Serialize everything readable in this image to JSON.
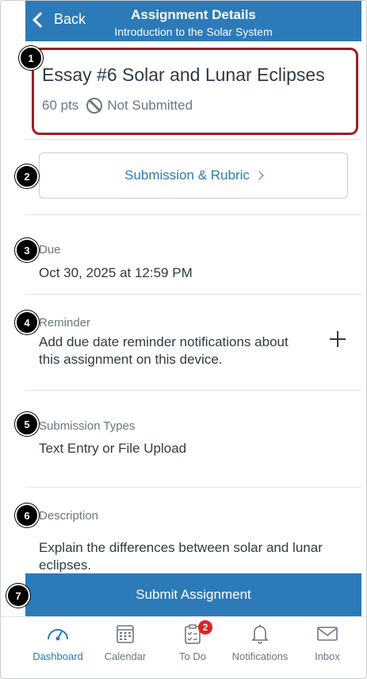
{
  "header": {
    "back_label": "Back",
    "title": "Assignment Details",
    "subtitle": "Introduction to the Solar System"
  },
  "assignment": {
    "title": "Essay #6 Solar and Lunar Eclipses",
    "points": "60 pts",
    "status": "Not Submitted"
  },
  "submission_button": {
    "label": "Submission & Rubric"
  },
  "due": {
    "label": "Due",
    "value": "Oct 30, 2025 at 12:59 PM"
  },
  "reminder": {
    "label": "Reminder",
    "text": "Add due date reminder notifications about this assignment on this device."
  },
  "submission_types": {
    "label": "Submission Types",
    "value": "Text Entry or File Upload"
  },
  "description": {
    "label": "Description",
    "text": "Explain the differences between solar and lunar eclipses."
  },
  "submit": {
    "label": "Submit Assignment"
  },
  "tabs": [
    {
      "label": "Dashboard",
      "icon": "dashboard-icon",
      "active": true
    },
    {
      "label": "Calendar",
      "icon": "calendar-icon",
      "active": false
    },
    {
      "label": "To Do",
      "icon": "todo-icon",
      "active": false,
      "badge": "2"
    },
    {
      "label": "Notifications",
      "icon": "bell-icon",
      "active": false
    },
    {
      "label": "Inbox",
      "icon": "mail-icon",
      "active": false
    }
  ],
  "callouts": [
    "1",
    "2",
    "3",
    "4",
    "5",
    "6",
    "7"
  ],
  "colors": {
    "brand": "#2d7ab8",
    "highlight": "#9c1e23",
    "badge": "#e02222"
  }
}
